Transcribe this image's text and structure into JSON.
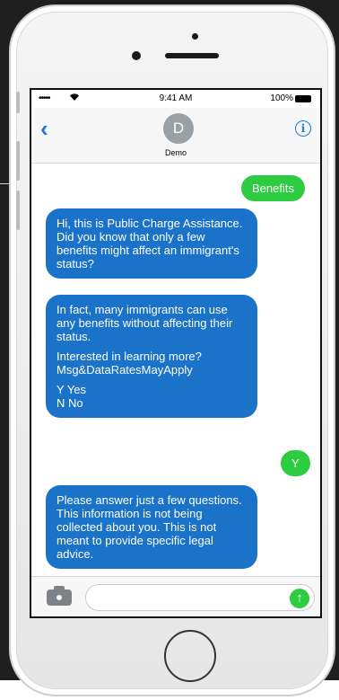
{
  "status_bar": {
    "signal": "•••••",
    "time": "9:41 AM",
    "battery_pct": "100%"
  },
  "header": {
    "back_icon": "chevron-left-icon",
    "avatar_initial": "D",
    "contact_name": "Demo",
    "info_icon": "info-icon"
  },
  "messages": [
    {
      "direction": "outgoing",
      "paragraphs": [
        "Benefits"
      ]
    },
    {
      "direction": "incoming",
      "paragraphs": [
        "Hi, this is Public Charge Assistance. Did you know that only a few benefits might affect an immigrant's status?"
      ]
    },
    {
      "direction": "incoming",
      "paragraphs": [
        "In fact, many immigrants can use any benefits without affecting their status.",
        "Interested in learning more? Msg&DataRatesMayApply",
        "Y Yes\nN No"
      ]
    },
    {
      "direction": "outgoing",
      "paragraphs": [
        "Y"
      ]
    },
    {
      "direction": "incoming",
      "paragraphs": [
        "Please answer just a few questions. This information is not being collected about you. This is not meant to provide specific legal advice."
      ]
    }
  ],
  "composer": {
    "camera_icon": "camera-icon",
    "input_value": "",
    "send_icon": "arrow-up-icon"
  },
  "colors": {
    "outgoing_bubble": "#2ecc40",
    "incoming_bubble": "#1a73c8",
    "accent": "#1e7bd7"
  }
}
